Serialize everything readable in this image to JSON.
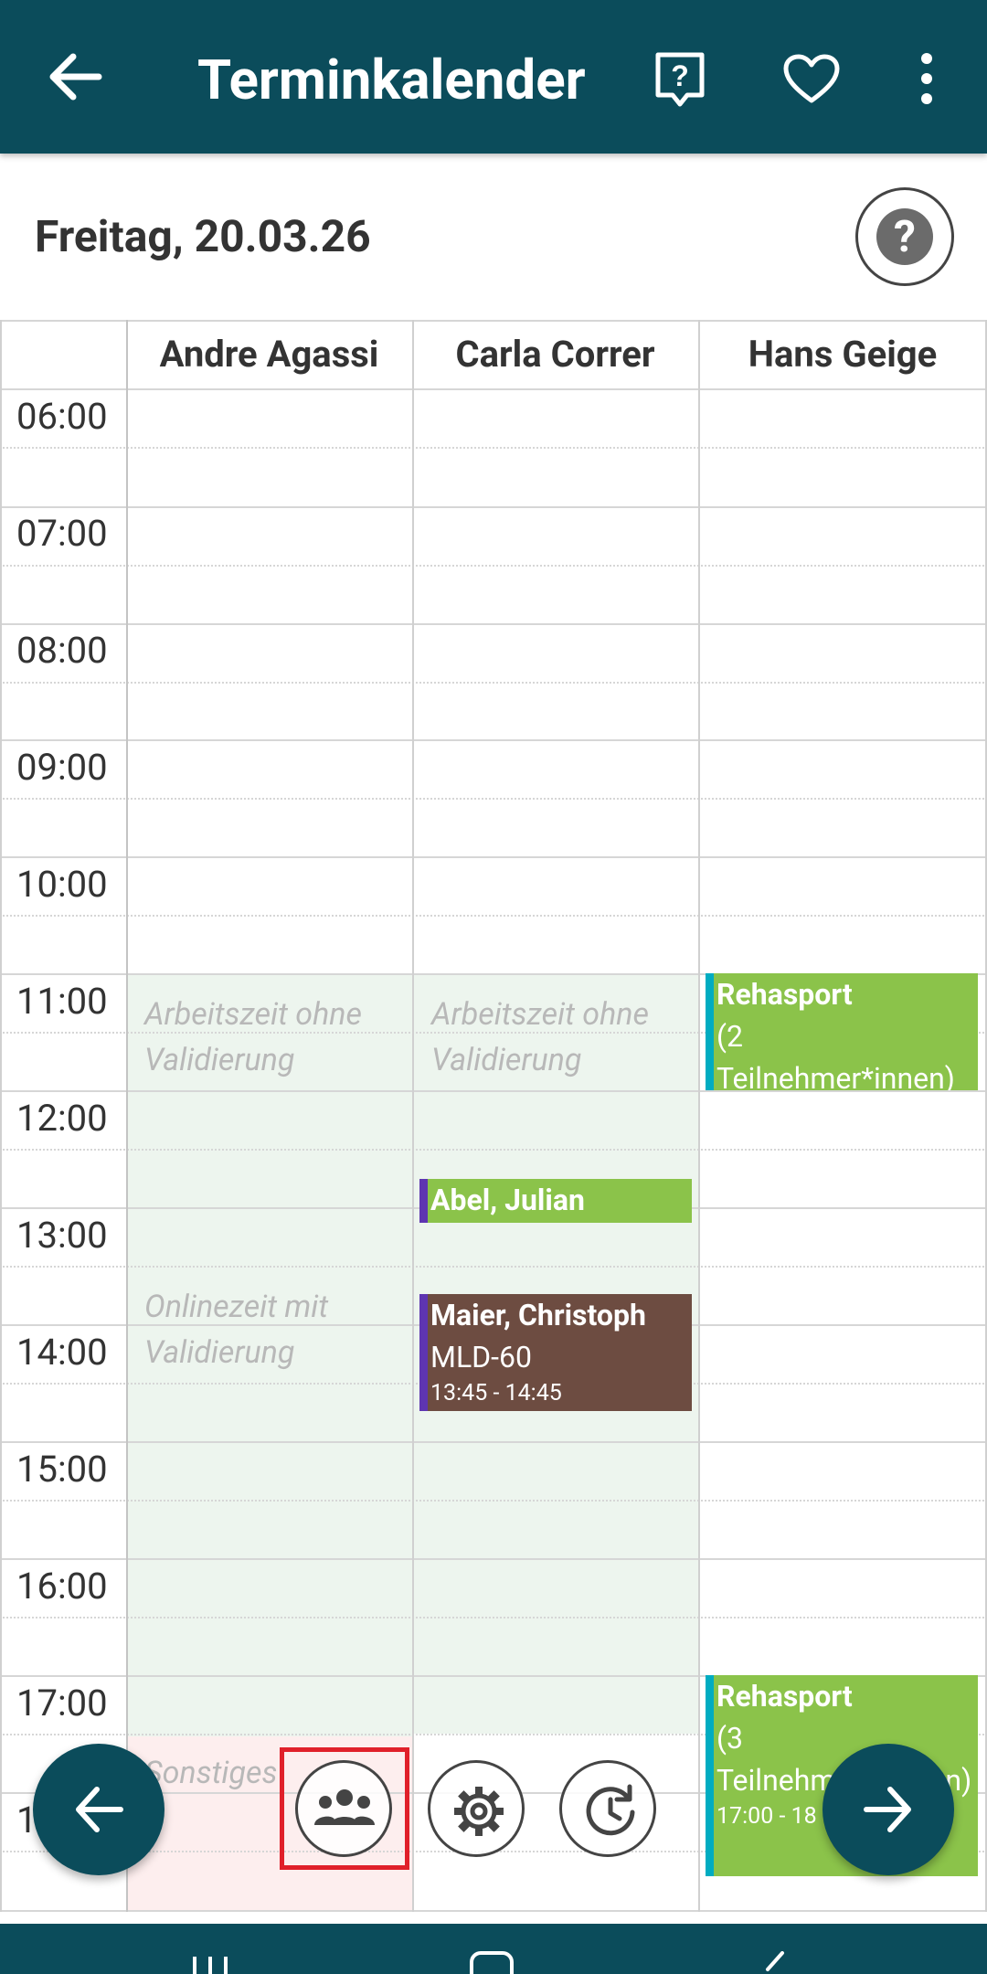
{
  "appbar": {
    "title": "Terminkalender",
    "back_icon": "arrow-left-icon",
    "help_icon": "question-bubble-icon",
    "fav_icon": "heart-icon",
    "menu_icon": "more-vertical-icon"
  },
  "header": {
    "date": "Freitag, 20.03.26",
    "help_icon": "help-circle-icon"
  },
  "calendar": {
    "columns": [
      "Andre Agassi",
      "Carla Correr",
      "Hans Geige"
    ],
    "times": [
      "06:00",
      "07:00",
      "08:00",
      "09:00",
      "10:00",
      "11:00",
      "12:00",
      "13:00",
      "14:00",
      "15:00",
      "16:00",
      "17:00",
      "1"
    ],
    "hints": {
      "andre_arbeitszeit": [
        "Arbeitszeit ohne",
        "Validierung"
      ],
      "carla_arbeitszeit": [
        "Arbeitszeit ohne",
        "Validierung"
      ],
      "andre_onlinezeit": [
        "Onlinezeit mit",
        "Validierung"
      ],
      "andre_sonstiges": "Sonstiges"
    },
    "events": {
      "rehasport1": {
        "title": "Rehasport",
        "line2": "(2",
        "line3": "Teilnehmer*innen)"
      },
      "abel": {
        "title": "Abel, Julian"
      },
      "maier": {
        "title": "Maier, Christoph",
        "line2": "MLD-60",
        "time": "13:45 - 14:45"
      },
      "rehasport2": {
        "title": "Rehasport",
        "line2": "(3",
        "line3": "Teilnehm",
        "line3b": "n)",
        "time": "17:00 - 18"
      }
    },
    "colors": {
      "green": "#8bc34a",
      "brown": "#6d4c41",
      "purple": "#5e35b1",
      "teal_strip": "#00acc1",
      "work_shade": "#edf5ee",
      "misc_shade": "#fdeeee"
    }
  },
  "toolbar": {
    "prev_icon": "arrow-left-icon",
    "group_icon": "group-icon",
    "settings_icon": "gear-icon",
    "history_icon": "clock-rotate-icon",
    "next_icon": "arrow-right-icon"
  },
  "theme": {
    "primary": "#0b4c5b",
    "selection": "#e0202a"
  }
}
